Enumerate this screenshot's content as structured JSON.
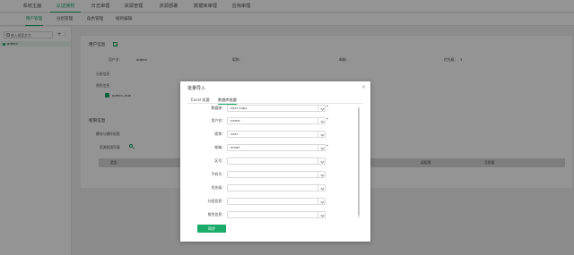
{
  "topnav": {
    "tabs": [
      "系统主面",
      "认证授权",
      "日志审理",
      "资源管理",
      "资源部署",
      "数据库审理",
      "应用审理"
    ],
    "active_index": 1
  },
  "subnav": {
    "items": [
      "用户管理",
      "分组管理",
      "角色管理",
      "规则编辑"
    ],
    "active_index": 0
  },
  "sidebar": {
    "search_placeholder": "输入搜索文字",
    "add_label": "+",
    "more_label": "⋮",
    "tree_items": [
      "admin"
    ]
  },
  "main": {
    "user_info_title": "用户信息",
    "fields": {
      "username_label": "用户名：",
      "username_value": "admin",
      "nickname_label": "昵称：",
      "email_label": "邮箱：",
      "priority_label": "优先级：",
      "priority_value": "3"
    },
    "group_label": "分组信息",
    "role_label": "角色信息",
    "role_value": "admin_role",
    "perm_title": "权限信息",
    "perm_sub": "模块与操作权限",
    "resource_label": "资源权限列表",
    "table_headers": [
      "类型",
      "读权限",
      "写权限"
    ]
  },
  "modal": {
    "title": "批量导入",
    "close": "×",
    "tabs": [
      "Excel 批量",
      "数据库批量"
    ],
    "active_tab": 1,
    "fields": [
      {
        "label": "数据源：",
        "value": "user copy",
        "required": true
      },
      {
        "label": "用户名：",
        "value": "name",
        "required": true
      },
      {
        "label": "昵称：",
        "value": "user",
        "required": false
      },
      {
        "label": "邮箱：",
        "value": "email",
        "required": true
      },
      {
        "label": "区号：",
        "value": "",
        "required": false
      },
      {
        "label": "手机号：",
        "value": "",
        "required": false
      },
      {
        "label": "优先级：",
        "value": "",
        "required": false
      },
      {
        "label": "分组信息：",
        "value": "",
        "required": false
      },
      {
        "label": "角色信息：",
        "value": "",
        "required": false
      }
    ],
    "sync_button": "同步"
  },
  "colors": {
    "accent": "#1aab68",
    "overlay": "rgba(0,0,0,0.42)"
  }
}
